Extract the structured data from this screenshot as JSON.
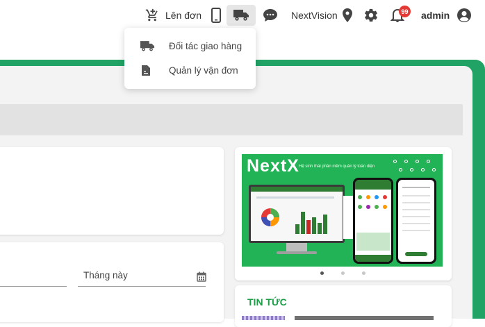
{
  "topbar": {
    "order_label": "Lên đơn",
    "brand_label": "NextVision",
    "notification_count": "99",
    "user_label": "admin"
  },
  "dropdown": {
    "items": [
      {
        "label": "Đối tác giao hàng",
        "icon": "truck-icon"
      },
      {
        "label": "Quản lý vận đơn",
        "icon": "document-icon"
      }
    ]
  },
  "filter": {
    "date_value": "Tháng này"
  },
  "banner": {
    "brand": "NextX",
    "tagline": "Hệ sinh thái phần mềm quản lý toàn diện"
  },
  "news": {
    "title": "TIN TỨC"
  },
  "colors": {
    "accent_green": "#21a366",
    "badge_red": "#e53935"
  }
}
